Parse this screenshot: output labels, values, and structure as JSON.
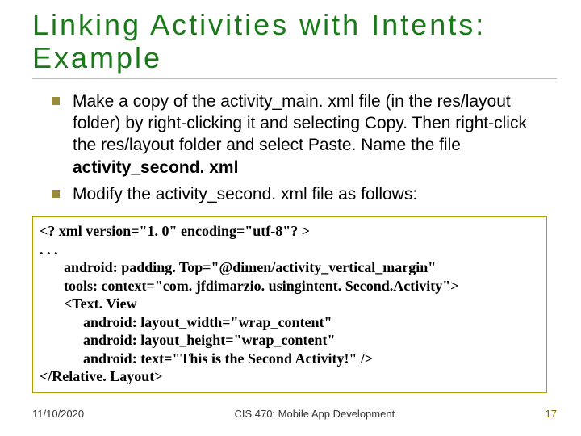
{
  "title_line1": "Linking  Activities  with  Intents:",
  "title_line2": "Example",
  "bullets": [
    {
      "pre": "Make a copy of the activity_main. xml file (in the res/layout folder) by right-clicking it and selecting Copy. Then right-click the res/layout folder and select Paste. Name the file ",
      "bold": "activity_second. xml",
      "post": ""
    },
    {
      "pre": "Modify the activity_second. xml file as follows:",
      "bold": "",
      "post": ""
    }
  ],
  "code": {
    "l0": "<? xml version=\"1. 0\" encoding=\"utf-8\"? >",
    "l1": ". . .",
    "l2": "android: padding. Top=\"@dimen/activity_vertical_margin\"",
    "l3": "tools: context=\"com. jfdimarzio. usingintent. Second.Activity\">",
    "l4": "<Text. View",
    "l5": "android: layout_width=\"wrap_content\"",
    "l6": "android: layout_height=\"wrap_content\"",
    "l7": "android: text=\"This is the Second Activity!\" />",
    "l8": "</Relative. Layout>"
  },
  "footer": {
    "date": "11/10/2020",
    "course": "CIS 470: Mobile App Development",
    "page": "17"
  }
}
